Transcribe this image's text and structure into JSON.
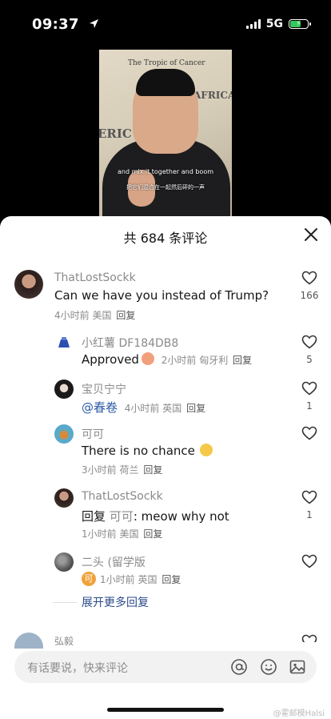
{
  "status_bar": {
    "time": "09:37",
    "network": "5G",
    "battery_icon": "battery-charging-icon",
    "location_icon": "location-arrow-icon"
  },
  "video": {
    "map_text_top": "The Tropic of Cancer",
    "map_text_right": "AFRICA",
    "map_text_left": "ERIC",
    "subtitle_en": "and mix it together and boom",
    "subtitle_zh": "把它们混合在一起然后砰的一声"
  },
  "sheet": {
    "title": "共 684 条评论",
    "close_icon": "close-icon"
  },
  "comments": [
    {
      "username": "ThatLostSockk",
      "text": "Can we have you instead of Trump?",
      "time": "4小时前",
      "location": "美国",
      "reply": "回复",
      "likes": "166"
    },
    {
      "username": "小红薯 DF184DB8",
      "text": "Approved",
      "time": "2小时前",
      "location": "匈牙利",
      "reply": "回复",
      "likes": "5"
    },
    {
      "username": "宝贝宁宁",
      "mention": "@春卷",
      "time": "4小时前",
      "location": "英国",
      "reply": "回复",
      "likes": "1"
    },
    {
      "username": "可可",
      "text": "There is no chance",
      "time": "3小时前",
      "location": "荷兰",
      "reply": "回复",
      "likes": ""
    },
    {
      "username": "ThatLostSockk",
      "reply_prefix": "回复",
      "reply_to": "可可",
      "text": ": meow why not",
      "time": "1小时前",
      "location": "美国",
      "reply": "回复",
      "likes": "1"
    },
    {
      "username": "二头 (留学版",
      "time": "1小时前",
      "location": "英国",
      "reply": "回复",
      "likes": "",
      "badge": "可"
    },
    {
      "username": "弘毅"
    }
  ],
  "expand_label": "展开更多回复",
  "input": {
    "placeholder": "有话要说，快来评论",
    "icons": [
      "at-icon",
      "emoji-icon",
      "image-icon"
    ]
  },
  "watermark": "@霍邮模Halsi"
}
